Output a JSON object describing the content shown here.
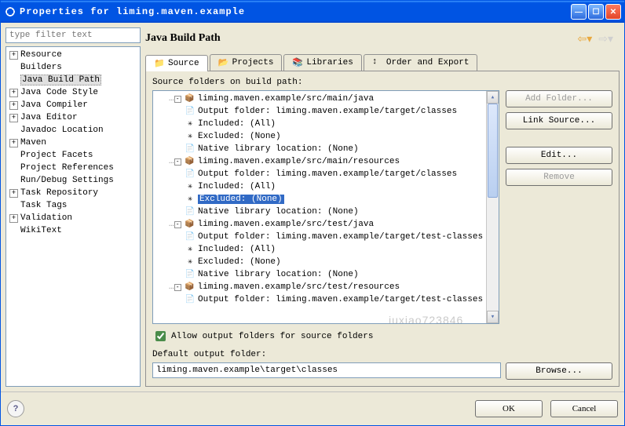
{
  "titlebar": {
    "title": "Properties for liming.maven.example"
  },
  "filter": {
    "placeholder": "type filter text"
  },
  "left_tree": [
    {
      "exp": "+",
      "label": "Resource"
    },
    {
      "exp": "",
      "label": "Builders"
    },
    {
      "exp": "",
      "label": "Java Build Path",
      "selected": true
    },
    {
      "exp": "+",
      "label": "Java Code Style"
    },
    {
      "exp": "+",
      "label": "Java Compiler"
    },
    {
      "exp": "+",
      "label": "Java Editor"
    },
    {
      "exp": "",
      "label": "Javadoc Location"
    },
    {
      "exp": "+",
      "label": "Maven"
    },
    {
      "exp": "",
      "label": "Project Facets"
    },
    {
      "exp": "",
      "label": "Project References"
    },
    {
      "exp": "",
      "label": "Run/Debug Settings"
    },
    {
      "exp": "+",
      "label": "Task Repository"
    },
    {
      "exp": "",
      "label": "Task Tags"
    },
    {
      "exp": "+",
      "label": "Validation"
    },
    {
      "exp": "",
      "label": "WikiText"
    }
  ],
  "page": {
    "title": "Java Build Path"
  },
  "tabs": [
    {
      "label": "Source",
      "active": true,
      "icon": "📁"
    },
    {
      "label": "Projects",
      "icon": "📂"
    },
    {
      "label": "Libraries",
      "icon": "📚"
    },
    {
      "label": "Order and Export",
      "icon": "↕"
    }
  ],
  "source_header": "Source folders on build path:",
  "src_tree": [
    {
      "indent": 1,
      "exp": "-",
      "icon": "📦",
      "text": "liming.maven.example/src/main/java"
    },
    {
      "indent": 2,
      "icon": "📄",
      "text": "Output folder: liming.maven.example/target/classes"
    },
    {
      "indent": 2,
      "icon": "✳",
      "text": "Included: (All)"
    },
    {
      "indent": 2,
      "icon": "✳",
      "text": "Excluded: (None)"
    },
    {
      "indent": 2,
      "icon": "📄",
      "text": "Native library location: (None)"
    },
    {
      "indent": 1,
      "exp": "-",
      "icon": "📦",
      "text": "liming.maven.example/src/main/resources"
    },
    {
      "indent": 2,
      "icon": "📄",
      "text": "Output folder: liming.maven.example/target/classes"
    },
    {
      "indent": 2,
      "icon": "✳",
      "text": "Included: (All)"
    },
    {
      "indent": 2,
      "icon": "✳",
      "text": "Excluded: (None)",
      "selected": true
    },
    {
      "indent": 2,
      "icon": "📄",
      "text": "Native library location: (None)"
    },
    {
      "indent": 1,
      "exp": "-",
      "icon": "📦",
      "text": "liming.maven.example/src/test/java"
    },
    {
      "indent": 2,
      "icon": "📄",
      "text": "Output folder: liming.maven.example/target/test-classes"
    },
    {
      "indent": 2,
      "icon": "✳",
      "text": "Included: (All)"
    },
    {
      "indent": 2,
      "icon": "✳",
      "text": "Excluded: (None)"
    },
    {
      "indent": 2,
      "icon": "📄",
      "text": "Native library location: (None)"
    },
    {
      "indent": 1,
      "exp": "-",
      "icon": "📦",
      "text": "liming.maven.example/src/test/resources"
    },
    {
      "indent": 2,
      "icon": "📄",
      "text": "Output folder: liming.maven.example/target/test-classes"
    }
  ],
  "src_buttons": {
    "add_folder": "Add Folder...",
    "link_source": "Link Source...",
    "edit": "Edit...",
    "remove": "Remove"
  },
  "allow_label": "Allow output folders for source folders",
  "default_label": "Default output folder:",
  "default_value": "liming.maven.example\\target\\classes",
  "browse": "Browse...",
  "footer": {
    "ok": "OK",
    "cancel": "Cancel"
  },
  "watermark": "iuxiao723846"
}
